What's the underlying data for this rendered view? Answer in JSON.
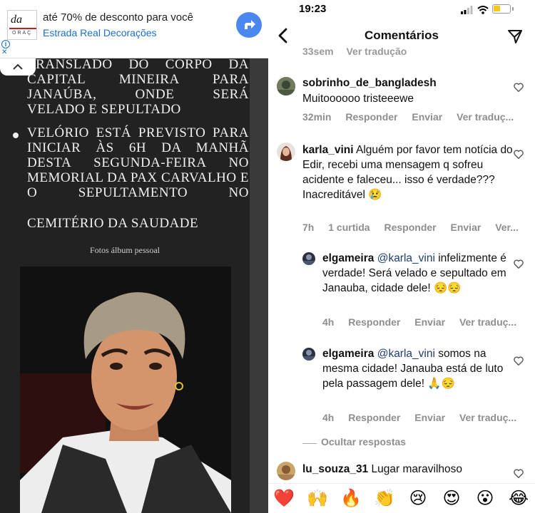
{
  "ad": {
    "title": "até 70% de desconto para você",
    "subtitle": "Estrada Real Decorações",
    "logo_text": "da",
    "logo_sub": "ORAÇ"
  },
  "article": {
    "para1": "TRANSLADO DO CORPO DA CAPITAL MINEIRA PARA JANAÚBA, ONDE SERÁ",
    "para1_last": "VELADO E SEPULTADO",
    "para2": "VELÓRIO ESTÁ PREVISTO PARA INICIAR ÀS 6H DA MANHÃ DESTA SEGUNDA-FEIRA NO MEMORIAL DA PAX CARVALHO E O SEPULTAMENTO NO",
    "para2_last": "CEMITÉRIO DA SAUDADE",
    "caption": "Fotos álbum pessoal"
  },
  "status": {
    "time": "19:23"
  },
  "header": {
    "title": "Comentários"
  },
  "previous_meta": {
    "time": "33sem",
    "translate": "Ver tradução"
  },
  "comments": [
    {
      "username": "sobrinho_de_bangladesh",
      "text": "Muitoooooo tristeeewe",
      "time": "32min",
      "likes": "",
      "reply": "Responder",
      "send": "Enviar",
      "translate": "Ver traduç..."
    },
    {
      "username": "karla_vini",
      "text": "Alguém por favor tem notícia do Edir, recebi uma mensagem q sofreu acidente e faleceu... isso é verdade??? Inacreditável 😢",
      "time": "7h",
      "likes": "1 curtida",
      "reply": "Responder",
      "send": "Enviar",
      "translate": "Ver..."
    },
    {
      "username": "elgameira",
      "mention": "@karla_vini",
      "text": "infelizmente é verdade! Será velado e sepultado em Janauba, cidade dele! 😔😔",
      "time": "4h",
      "reply": "Responder",
      "send": "Enviar",
      "translate": "Ver traduç..."
    },
    {
      "username": "elgameira",
      "mention": "@karla_vini",
      "text": "somos na mesma cidade! Janauba está de luto pela passagem dele! 🙏😔",
      "time": "4h",
      "reply": "Responder",
      "send": "Enviar",
      "translate": "Ver traduç..."
    },
    {
      "username": "lu_souza_31",
      "text": "Lugar maravilhoso"
    }
  ],
  "hide_replies": "Ocultar respostas",
  "emojis": [
    "❤️",
    "🙌",
    "🔥",
    "👏",
    "😢",
    "😍",
    "😮",
    "😂"
  ],
  "colors": {
    "mention": "#1d3d73",
    "ad_link": "#1a6fd1",
    "meta_gray": "#8e8e8e"
  }
}
